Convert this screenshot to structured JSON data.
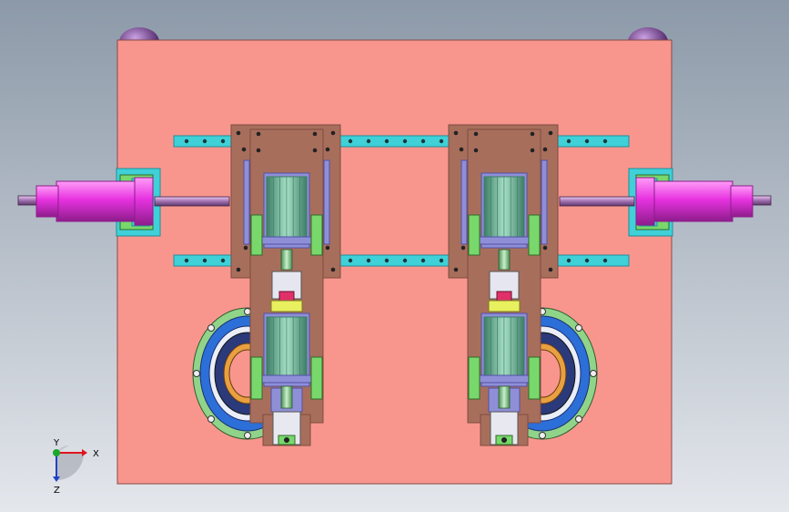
{
  "viewport": {
    "background_top": "#8c99a8",
    "background_bottom": "#e4e7ec"
  },
  "colors": {
    "plate": "#f8968e",
    "plate_edge": "#8a4a46",
    "carriage": "#a86e5c",
    "carriage_dark": "#7e4c40",
    "rail": "#3fd0d8",
    "rail_dark": "#1f8f98",
    "cylinder": "#e733e0",
    "cylinder_dark": "#8e1c8c",
    "rod": "#b080b8",
    "motor": "#6ab79a",
    "motor_dark": "#3d7e66",
    "mount": "#8f8fd8",
    "mount_dark": "#5252a6",
    "bracket_green": "#78d86c",
    "ring_outer": "#90d48a",
    "ring_blue": "#2c6fd8",
    "ring_dark": "#1d2f6e",
    "ring_orange": "#e8a040",
    "knob": "#6a2e86",
    "yellow": "#e8f060"
  },
  "triad": {
    "x_label": "X",
    "y_label": "Y",
    "z_label": "Z",
    "x_color": "#e0141e",
    "y_color": "#18a82c",
    "z_color": "#2040c8"
  },
  "icons": {
    "triad": "coordinate-triad-icon"
  }
}
